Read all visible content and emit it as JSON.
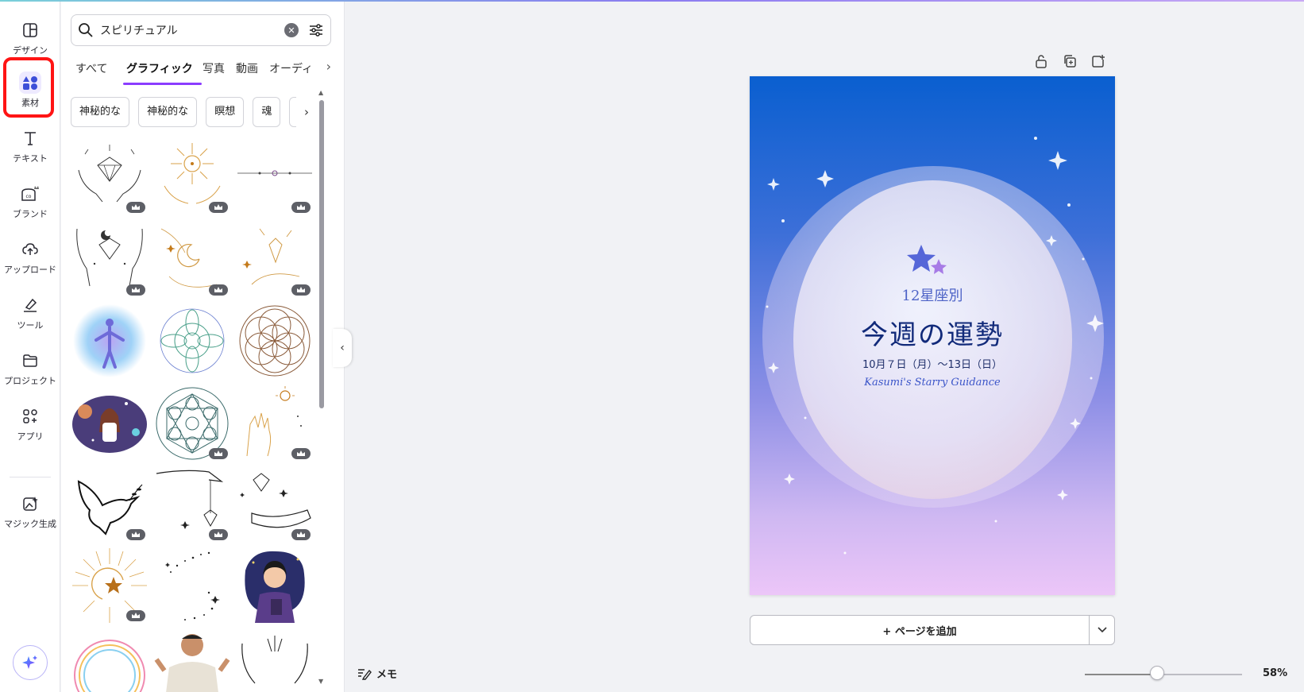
{
  "rail": {
    "items": [
      {
        "label": "デザイン",
        "icon": "layout-icon"
      },
      {
        "label": "素材",
        "icon": "elements-icon"
      },
      {
        "label": "テキスト",
        "icon": "text-icon"
      },
      {
        "label": "ブランド",
        "icon": "brand-icon"
      },
      {
        "label": "アップロード",
        "icon": "upload-icon"
      },
      {
        "label": "ツール",
        "icon": "draw-icon"
      },
      {
        "label": "プロジェクト",
        "icon": "folder-icon"
      },
      {
        "label": "アプリ",
        "icon": "apps-icon"
      },
      {
        "label": "マジック生成",
        "icon": "magic-media-icon"
      }
    ],
    "active_index": 1,
    "highlight_color": "#ff1414"
  },
  "panel": {
    "search_value": "スピリチュアル",
    "tabs": [
      "すべて",
      "グラフィック",
      "写真",
      "動画",
      "オーディ"
    ],
    "active_tab": 1,
    "chips": [
      "神秘的な",
      "神秘的な",
      "瞑想",
      "魂",
      "夕"
    ],
    "accent": "#8b3dff"
  },
  "design": {
    "subtitle": "12星座別",
    "title": "今週の運勢",
    "date": "10月７日（月）〜13日（日）",
    "signature": "Kasumi's Starry Guidance"
  },
  "canvas": {
    "add_page_label": "+ ページを追加"
  },
  "footer": {
    "memo_label": "メモ",
    "zoom_percent": 58,
    "zoom_label": "58%"
  }
}
